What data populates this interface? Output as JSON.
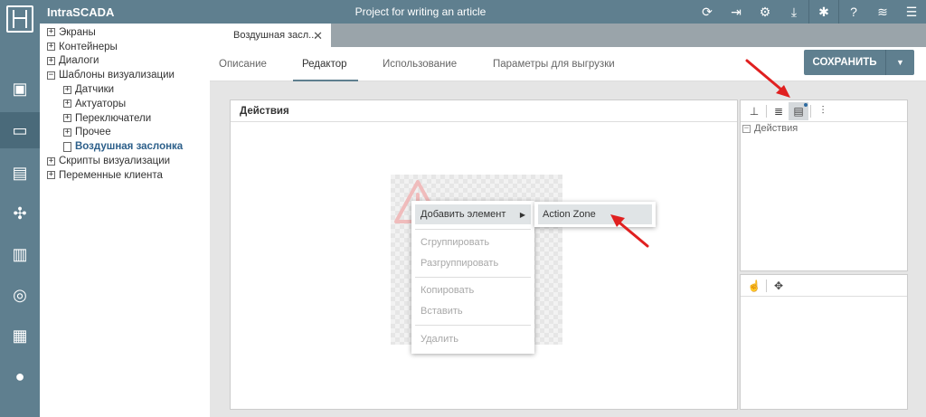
{
  "app": {
    "name": "IntraSCADA",
    "project_title": "Project for writing an article"
  },
  "topbar": {
    "icons": [
      "refresh-icon",
      "exit-icon",
      "settings-gear-icon",
      "download-icon",
      "bug-icon",
      "help-icon",
      "wifi-icon",
      "menu-icon"
    ]
  },
  "sidebar": {
    "items": [
      "cpu-chip-icon",
      "monitor-icon",
      "document-icon",
      "puzzle-icon",
      "bar-chart-icon",
      "database-icon",
      "archive-icon",
      "user-icon"
    ],
    "active_index": 1
  },
  "tree": {
    "items": [
      {
        "label": "Экраны",
        "state": "+",
        "level": 0
      },
      {
        "label": "Контейнеры",
        "state": "+",
        "level": 0
      },
      {
        "label": "Диалоги",
        "state": "+",
        "level": 0
      },
      {
        "label": "Шаблоны визуализации",
        "state": "−",
        "level": 0
      },
      {
        "label": "Датчики",
        "state": "+",
        "level": 1
      },
      {
        "label": "Актуаторы",
        "state": "+",
        "level": 1
      },
      {
        "label": "Переключатели",
        "state": "+",
        "level": 1
      },
      {
        "label": "Прочее",
        "state": "+",
        "level": 1
      },
      {
        "label": "Воздушная заслонка",
        "state": "file",
        "level": 1,
        "selected": true
      },
      {
        "label": "Скрипты визуализации",
        "state": "+",
        "level": 0
      },
      {
        "label": "Переменные клиента",
        "state": "+",
        "level": 0
      }
    ]
  },
  "doc_tab": {
    "label": "Воздушная засл...",
    "close": "✕"
  },
  "sub_tabs": [
    {
      "label": "Описание"
    },
    {
      "label": "Редактор",
      "active": true
    },
    {
      "label": "Использование"
    },
    {
      "label": "Параметры для выгрузки"
    }
  ],
  "save_button": {
    "label": "СОХРАНИТЬ",
    "dropdown": "▼"
  },
  "actions_panel": {
    "title": "Действия"
  },
  "context_menu": {
    "items": [
      {
        "label": "Добавить элемент",
        "submenu": true,
        "arrow": "▶"
      },
      {
        "label": "Сгруппировать",
        "disabled": true
      },
      {
        "label": "Разгруппировать",
        "disabled": true
      },
      {
        "label": "Копировать",
        "disabled": true
      },
      {
        "label": "Вставить",
        "disabled": true
      },
      {
        "label": "Удалить",
        "disabled": true
      }
    ]
  },
  "submenu": {
    "items": [
      {
        "label": "Action Zone"
      }
    ]
  },
  "right_panel": {
    "tree_root": {
      "label": "Действия",
      "state": "−"
    },
    "toolbar_icons": [
      "hierarchy-icon",
      "list-icon",
      "actions-icon",
      "sliders-icon"
    ],
    "bottom_toolbar_icons": [
      "pointer-hand-icon",
      "move-icon"
    ]
  },
  "colors": {
    "primary": "#5f7f8f",
    "annotation_arrow": "#e02020"
  }
}
